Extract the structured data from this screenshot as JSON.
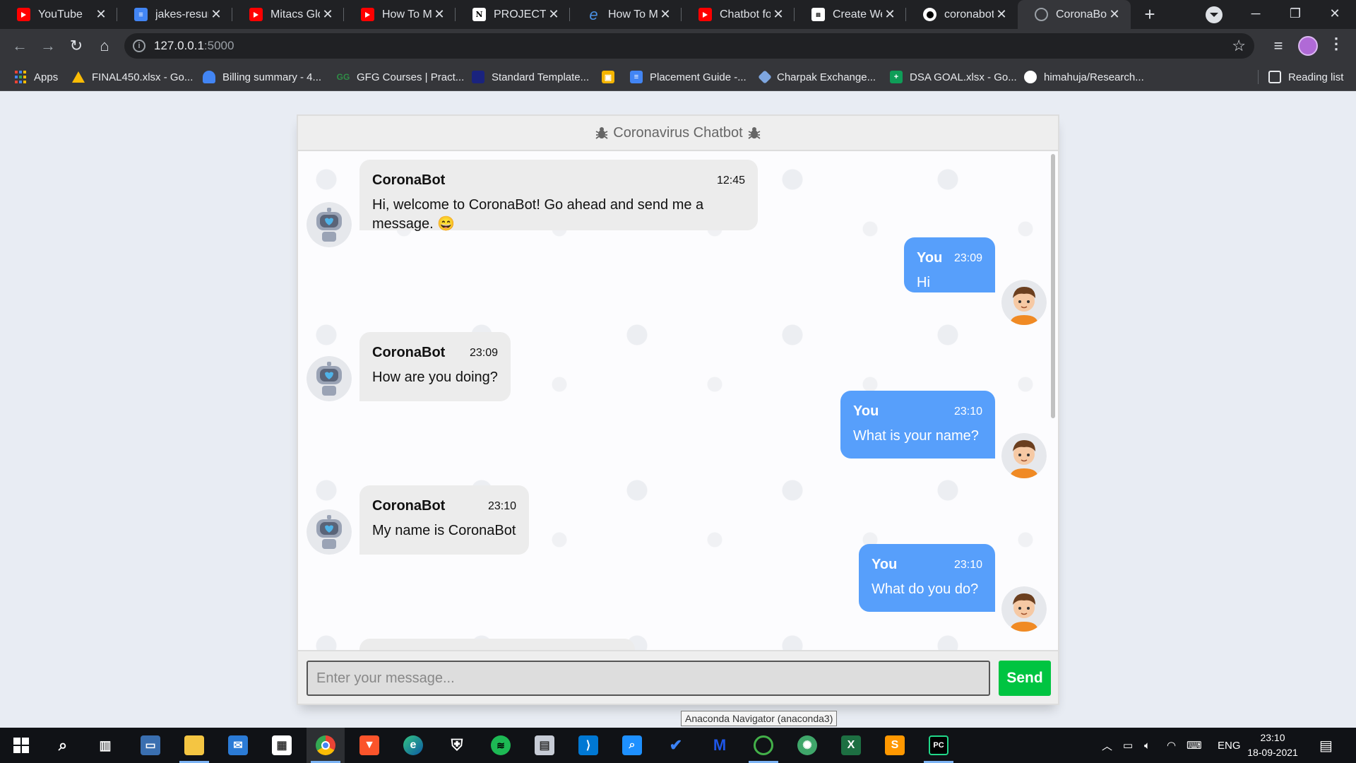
{
  "browser": {
    "tabs": [
      {
        "title": "YouTube",
        "icon": "youtube-icon",
        "x": 0
      },
      {
        "title": "jakes-resum",
        "icon": "google-docs-icon"
      },
      {
        "title": "Mitacs Glob",
        "icon": "youtube-icon"
      },
      {
        "title": "How To Mal",
        "icon": "youtube-icon"
      },
      {
        "title": "PROJECTS",
        "icon": "notion-icon"
      },
      {
        "title": "How To Mal",
        "icon": "edureka-icon"
      },
      {
        "title": "Chatbot for",
        "icon": "youtube-icon"
      },
      {
        "title": "Create Web",
        "icon": "page-icon"
      },
      {
        "title": "coronabot-",
        "icon": "github-icon"
      },
      {
        "title": "CoronaBot",
        "icon": "globe-icon",
        "active": true
      }
    ],
    "url_host": "127.0.0.1",
    "url_port": ":5000",
    "bookmarks": [
      {
        "label": "Apps",
        "icon": "apps-grid-icon"
      },
      {
        "label": "FINAL450.xlsx - Go...",
        "icon": "google-drive-icon"
      },
      {
        "label": "Billing summary - 4...",
        "icon": "google-ads-icon"
      },
      {
        "label": "GFG Courses | Pract...",
        "icon": "gfg-icon"
      },
      {
        "label": "Standard Template...",
        "icon": "bookmark-icon"
      },
      {
        "label": "",
        "icon": "google-slides-icon"
      },
      {
        "label": "Placement Guide -...",
        "icon": "google-docs-icon"
      },
      {
        "label": "Charpak Exchange...",
        "icon": "charpak-icon"
      },
      {
        "label": "DSA GOAL.xlsx - Go...",
        "icon": "google-sheets-icon"
      },
      {
        "label": "himahuja/Research...",
        "icon": "github-icon"
      }
    ],
    "reading_list": "Reading list"
  },
  "chat": {
    "title": "Coronavirus Chatbot",
    "messages": [
      {
        "side": "left",
        "name": "CoronaBot",
        "time": "12:45",
        "text": "Hi, welcome to CoronaBot! Go ahead and send me a message. 😄"
      },
      {
        "side": "right",
        "name": "You",
        "time": "23:09",
        "text": "Hi"
      },
      {
        "side": "left",
        "name": "CoronaBot",
        "time": "23:09",
        "text": "How are you doing?"
      },
      {
        "side": "right",
        "name": "You",
        "time": "23:10",
        "text": "What is your name?"
      },
      {
        "side": "left",
        "name": "CoronaBot",
        "time": "23:10",
        "text": "My name is CoronaBot"
      },
      {
        "side": "right",
        "name": "You",
        "time": "23:10",
        "text": "What do you do?"
      }
    ],
    "input_placeholder": "Enter your message...",
    "input_value": "",
    "send_label": "Send"
  },
  "tooltip": "Anaconda Navigator (anaconda3)",
  "taskbar": {
    "apps": [
      "windows-start-icon",
      "search-icon",
      "task-view-icon",
      "desktop-app-icon",
      "file-explorer-icon",
      "mail-icon",
      "store-icon",
      "chrome-icon",
      "brave-icon",
      "edge-icon",
      "security-icon",
      "spotify-icon",
      "remote-icon",
      "vscode-icon",
      "magnifier-icon",
      "todo-icon",
      "malwarebytes-icon",
      "anaconda-icon",
      "jupyter-icon",
      "excel-icon",
      "sublime-icon",
      "pycharm-icon"
    ],
    "language": "ENG",
    "time": "23:10",
    "date": "18-09-2021"
  },
  "colors": {
    "bot_bubble": "#ececec",
    "user_bubble": "#579ffb",
    "send_button": "#00c441",
    "chrome_dark": "#202124"
  }
}
